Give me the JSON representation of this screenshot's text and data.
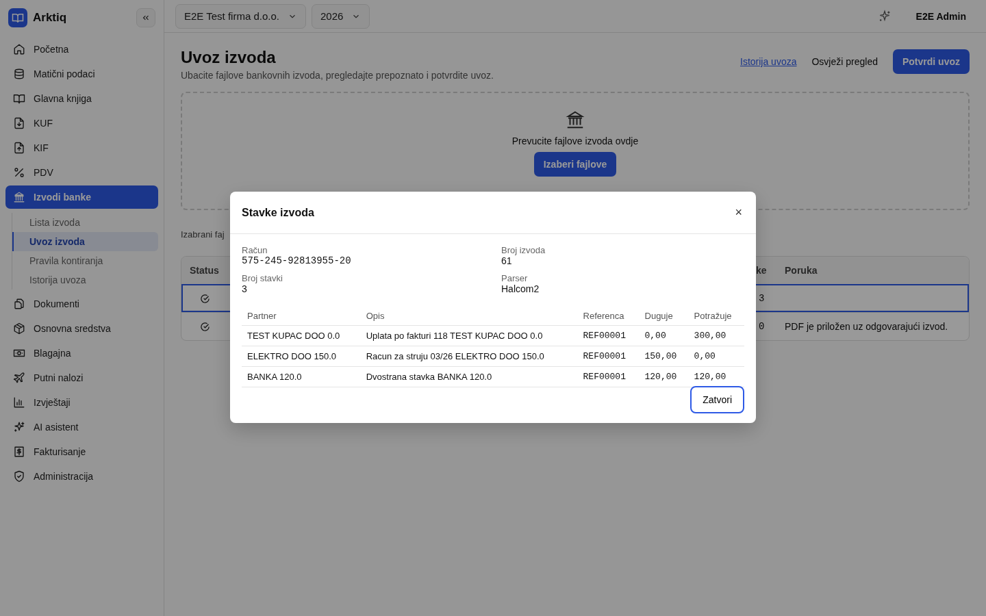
{
  "app": {
    "name": "Arktiq"
  },
  "sidebar": {
    "items": [
      {
        "label": "Početna",
        "selected": false
      },
      {
        "label": "Matični podaci",
        "selected": false
      },
      {
        "label": "Glavna knjiga",
        "selected": false
      },
      {
        "label": "KUF",
        "selected": false
      },
      {
        "label": "KIF",
        "selected": false
      },
      {
        "label": "PDV",
        "selected": false
      },
      {
        "label": "Izvodi banke",
        "selected": true,
        "expanded": true,
        "children": [
          {
            "label": "Lista izvoda",
            "selected": false
          },
          {
            "label": "Uvoz izvoda",
            "selected": true
          },
          {
            "label": "Pravila kontiranja",
            "selected": false
          },
          {
            "label": "Istorija uvoza",
            "selected": false
          }
        ]
      },
      {
        "label": "Dokumenti",
        "selected": false
      },
      {
        "label": "Osnovna sredstva",
        "selected": false
      },
      {
        "label": "Blagajna",
        "selected": false
      },
      {
        "label": "Putni nalozi",
        "selected": false
      },
      {
        "label": "Izvještaji",
        "selected": false
      },
      {
        "label": "AI asistent",
        "selected": false
      },
      {
        "label": "Fakturisanje",
        "selected": false
      },
      {
        "label": "Administracija",
        "selected": false
      }
    ]
  },
  "topbar": {
    "company": "E2E Test firma d.o.o.",
    "year": "2026",
    "user": "E2E Admin"
  },
  "page": {
    "title": "Uvoz izvoda",
    "subtitle": "Ubacite fajlove bankovnih izvoda, pregledajte prepoznato i potvrdite uvoz.",
    "actions": [
      {
        "label": "Istorija uvoza",
        "kind": "link"
      },
      {
        "label": "Osvježi pregled",
        "kind": "ghost"
      },
      {
        "label": "Potvrdi uvoz",
        "kind": "primary"
      }
    ]
  },
  "dropzone": {
    "text": "Prevucite fajlove izvoda ovdje",
    "button": "Izaberi fajlove"
  },
  "selected_files_label": "Izabrani faj",
  "table": {
    "columns": [
      "Status",
      "ke",
      "Poruka"
    ],
    "rows": [
      {
        "selected": true,
        "column_2": "3"
      },
      {
        "selected": false,
        "column_2": "0",
        "message": "PDF je priložen uz odgovarajući izvod."
      }
    ]
  },
  "modal": {
    "title": "Stavke izvoda",
    "close": "×",
    "fields": [
      {
        "label": "Račun",
        "value": "575-245-92813955-20",
        "kind": "mono"
      },
      {
        "label": "Broj izvoda",
        "value": "61",
        "kind": "text"
      },
      {
        "label": "Broj stavki",
        "value": "3",
        "kind": "text"
      },
      {
        "label": "Parser",
        "value": "Halcom2",
        "kind": "text"
      }
    ],
    "columns": [
      "Partner",
      "Opis",
      "Referenca",
      "Duguje",
      "Potražuje"
    ],
    "rows": [
      [
        "TEST KUPAC DOO 0.0",
        "Uplata po fakturi 118 TEST KUPAC DOO 0.0",
        "REF00001",
        "0,00",
        "300,00"
      ],
      [
        "ELEKTRO DOO 150.0",
        "Racun za struju 03/26 ELEKTRO DOO 150.0",
        "REF00001",
        "150,00",
        "0,00"
      ],
      [
        "BANKA 120.0",
        "Dvostrana stavka BANKA 120.0",
        "REF00001",
        "120,00",
        "120,00"
      ]
    ],
    "button": {
      "label": "Zatvori",
      "focused": true
    }
  }
}
